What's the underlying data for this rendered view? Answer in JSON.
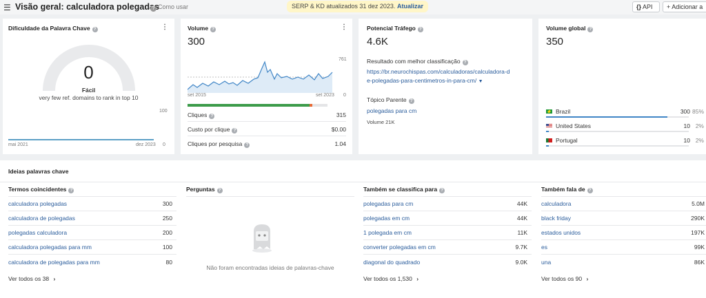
{
  "header": {
    "title": "Visão geral: calculadora polegadas",
    "howto": "Como usar",
    "banner_text": "SERP & KD atualizados 31 dez 2023.",
    "banner_link": "Atualizar",
    "api_label": "API",
    "add_label": "Adicionar a"
  },
  "kd": {
    "title": "Dificuldade da Palavra Chave",
    "value": "0",
    "level": "Fácil",
    "note": "very few ref. domains to rank in top 10",
    "axis_max": "100",
    "axis_min": "0",
    "x_start": "mai 2021",
    "x_end": "dez 2023",
    "gauge_fill_fraction": 0.0
  },
  "volume": {
    "title": "Volume",
    "value": "300",
    "axis_max": "761",
    "axis_min": "0",
    "x_start": "set 2015",
    "x_end": "set 2023",
    "split_fraction": 0.87,
    "rows": [
      {
        "label": "Cliques",
        "value": "315"
      },
      {
        "label": "Custo por clique",
        "value": "$0.00"
      },
      {
        "label": "Cliques por pesquisa",
        "value": "1.04"
      }
    ]
  },
  "traffic": {
    "title": "Potencial Tráfego",
    "value": "4.6K",
    "best_label": "Resultado com melhor classificação",
    "best_url_1": "https://br.neurochispas.com/calculadoras/calculadora-d",
    "best_url_2": "e-polegadas-para-centimetros-in-para-cm/",
    "parent_label": "Tópico Parente",
    "parent_link": "polegadas para cm",
    "parent_volume": "Volume 21K"
  },
  "global": {
    "title": "Volume global",
    "value": "350",
    "countries": [
      {
        "name": "Brazil",
        "value": "300",
        "pct": "85%",
        "fraction": 0.85
      },
      {
        "name": "United States",
        "value": "10",
        "pct": "2%",
        "fraction": 0.02
      },
      {
        "name": "Portugal",
        "value": "10",
        "pct": "2%",
        "fraction": 0.02
      }
    ]
  },
  "ideas": {
    "title": "Ideias palavras chave",
    "matching": {
      "title": "Termos coincidentes",
      "items": [
        {
          "kw": "calculadora polegadas",
          "v": "300"
        },
        {
          "kw": "calculadora de polegadas",
          "v": "250"
        },
        {
          "kw": "polegadas calculadora",
          "v": "200"
        },
        {
          "kw": "calculadora polegadas para mm",
          "v": "100"
        },
        {
          "kw": "calculadora de polegadas para mm",
          "v": "80"
        }
      ],
      "see_all": "Ver todos os 38"
    },
    "questions": {
      "title": "Perguntas",
      "empty": "Não foram encontradas ideias de palavras-chave"
    },
    "also_rank": {
      "title": "Também se classifica para",
      "items": [
        {
          "kw": "polegadas para cm",
          "v": "44K"
        },
        {
          "kw": "polegadas em cm",
          "v": "44K"
        },
        {
          "kw": "1 polegada em cm",
          "v": "11K"
        },
        {
          "kw": "converter polegadas em cm",
          "v": "9.7K"
        },
        {
          "kw": "diagonal do quadrado",
          "v": "9.0K"
        }
      ],
      "see_all": "Ver todos os 1,530"
    },
    "also_talk": {
      "title": "Também fala de",
      "items": [
        {
          "kw": "calculadora",
          "v": "5.0M"
        },
        {
          "kw": "black friday",
          "v": "290K"
        },
        {
          "kw": "estados unidos",
          "v": "197K"
        },
        {
          "kw": "es",
          "v": "99K"
        },
        {
          "kw": "una",
          "v": "86K"
        }
      ],
      "see_all": "Ver todos os 90"
    }
  }
}
